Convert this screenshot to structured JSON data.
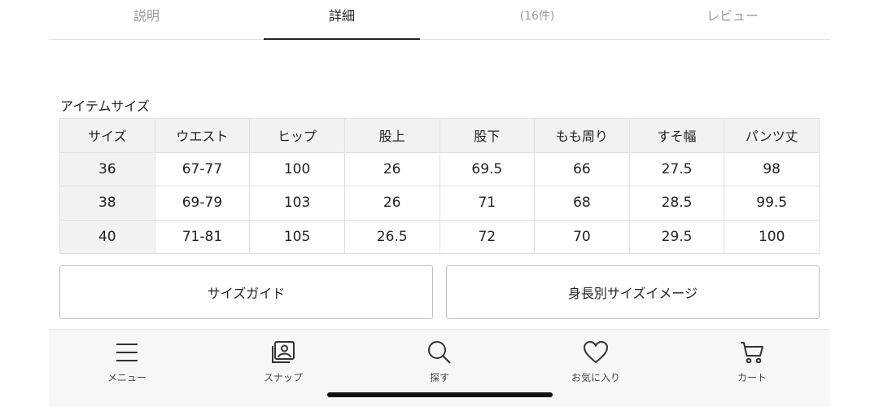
{
  "tabs": [
    {
      "label": "説明",
      "active": false
    },
    {
      "label": "詳細",
      "active": true
    },
    {
      "label": "(16件)",
      "active": false
    },
    {
      "label": "レビュー",
      "active": false
    }
  ],
  "item_size": {
    "title": "アイテムサイズ",
    "headers": [
      "サイズ",
      "ウエスト",
      "ヒップ",
      "股上",
      "股下",
      "もも周り",
      "すそ幅",
      "パンツ丈"
    ],
    "rows": [
      [
        "36",
        "67-77",
        "100",
        "26",
        "69.5",
        "66",
        "27.5",
        "98"
      ],
      [
        "38",
        "69-79",
        "103",
        "26",
        "71",
        "68",
        "28.5",
        "99.5"
      ],
      [
        "40",
        "71-81",
        "105",
        "26.5",
        "72",
        "70",
        "29.5",
        "100"
      ]
    ]
  },
  "buttons": {
    "size_guide": "サイズガイド",
    "height_size_image": "身長別サイズイメージ"
  },
  "bottom_nav": [
    {
      "label": "メニュー",
      "icon": "menu-icon"
    },
    {
      "label": "スナップ",
      "icon": "snap-icon"
    },
    {
      "label": "探す",
      "icon": "search-icon"
    },
    {
      "label": "お気に入り",
      "icon": "heart-icon"
    },
    {
      "label": "カート",
      "icon": "cart-icon"
    }
  ],
  "colors": {
    "active_tab_underline": "#222222",
    "header_cell_bg": "#f2f2f2",
    "nav_bg": "#f7f7f7"
  }
}
